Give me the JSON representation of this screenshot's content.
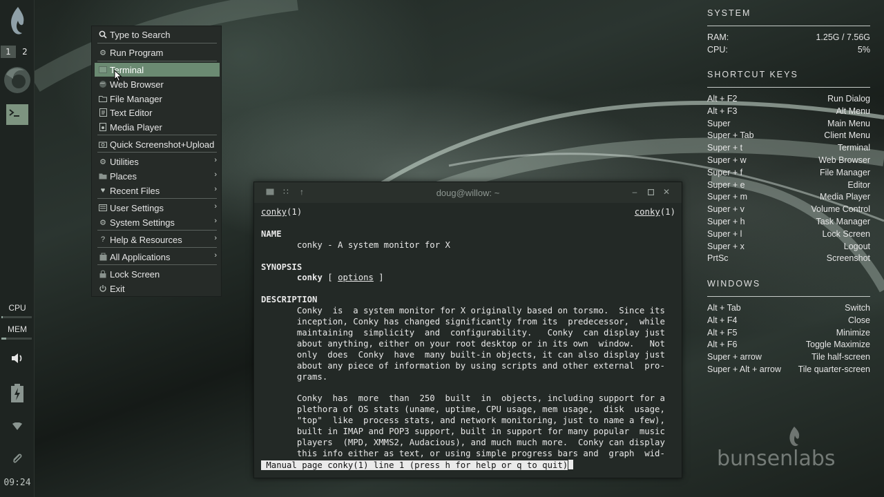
{
  "panel": {
    "workspaces": [
      "1",
      "2"
    ],
    "cpu_label": "CPU",
    "mem_label": "MEM",
    "cpu_fraction": 0.05,
    "mem_fraction": 0.16,
    "clock": "09:24"
  },
  "menu": {
    "items": [
      {
        "label": "Type to Search",
        "icon": "search-icon"
      },
      {
        "label": "Run Program",
        "icon": "gear-icon"
      },
      {
        "label": "Terminal",
        "icon": "terminal-icon",
        "highlighted": true
      },
      {
        "label": "Web Browser",
        "icon": "globe-icon"
      },
      {
        "label": "File Manager",
        "icon": "folder-icon"
      },
      {
        "label": "Text Editor",
        "icon": "text-editor-icon"
      },
      {
        "label": "Media Player",
        "icon": "media-player-icon"
      },
      {
        "label": "Quick Screenshot+Upload",
        "icon": "camera-icon"
      },
      {
        "label": "Utilities",
        "icon": "utilities-icon",
        "submenu": true
      },
      {
        "label": "Places",
        "icon": "folder-icon",
        "submenu": true
      },
      {
        "label": "Recent Files",
        "icon": "heart-icon",
        "submenu": true
      },
      {
        "label": "User Settings",
        "icon": "user-settings-icon",
        "submenu": true
      },
      {
        "label": "System Settings",
        "icon": "system-settings-icon",
        "submenu": true
      },
      {
        "label": "Help & Resources",
        "icon": "help-icon",
        "submenu": true
      },
      {
        "label": "All Applications",
        "icon": "applications-icon",
        "submenu": true
      },
      {
        "label": "Lock Screen",
        "icon": "lock-icon"
      },
      {
        "label": "Exit",
        "icon": "power-icon"
      }
    ]
  },
  "terminal": {
    "title": "doug@willow: ~",
    "header_left": "conky",
    "header_left_sect": "(1)",
    "header_right": "conky",
    "header_right_sect": "(1)",
    "name_heading": "NAME",
    "name_line": "       conky - A system monitor for X",
    "synopsis_heading": "SYNOPSIS",
    "synopsis_cmd": "conky",
    "synopsis_open": " [ ",
    "synopsis_opt": "options",
    "synopsis_close": " ]",
    "description_heading": "DESCRIPTION",
    "paragraph1": [
      "       Conky  is  a system monitor for X originally based on torsmo.  Since its",
      "       inception, Conky has changed significantly from its  predecessor,  while",
      "       maintaining  simplicity  and  configurability.   Conky  can display just",
      "       about anything, either on your root desktop or in its own  window.   Not",
      "       only  does  Conky  have  many built-in objects, it can also display just",
      "       about any piece of information by using scripts and other external  pro-",
      "       grams."
    ],
    "paragraph2": [
      "       Conky  has  more  than  250  built  in  objects, including support for a",
      "       plethora of OS stats (uname, uptime, CPU usage, mem usage,  disk  usage,",
      "       \"top\"  like  process stats, and network monitoring, just to name a few),",
      "       built in IMAP and POP3 support, built in support for many popular  music",
      "       players  (MPD, XMMS2, Audacious), and much much more.  Conky can display",
      "       this info either as text, or using simple progress bars and  graph  wid-"
    ],
    "status_line": " Manual page conky(1) line 1 (press h for help or q to quit)"
  },
  "conky": {
    "system_title": "SYSTEM",
    "system_rows": [
      {
        "key": "RAM:",
        "value": "1.25G / 7.56G"
      },
      {
        "key": "CPU:",
        "value": "5%"
      }
    ],
    "shortcut_title": "SHORTCUT KEYS",
    "shortcut_rows": [
      {
        "key": "Alt + F2",
        "value": "Run Dialog"
      },
      {
        "key": "Alt + F3",
        "value": "Alt Menu"
      },
      {
        "key": "Super",
        "value": "Main Menu"
      },
      {
        "key": "Super + Tab",
        "value": "Client Menu"
      },
      {
        "key": "Super + t",
        "value": "Terminal"
      },
      {
        "key": "Super + w",
        "value": "Web Browser"
      },
      {
        "key": "Super + f",
        "value": "File Manager"
      },
      {
        "key": "Super + e",
        "value": "Editor"
      },
      {
        "key": "Super + m",
        "value": "Media Player"
      },
      {
        "key": "Super + v",
        "value": "Volume Control"
      },
      {
        "key": "Super + h",
        "value": "Task Manager"
      },
      {
        "key": "Super + l",
        "value": "Lock Screen"
      },
      {
        "key": "Super + x",
        "value": "Logout"
      },
      {
        "key": "PrtSc",
        "value": "Screenshot"
      }
    ],
    "windows_title": "WINDOWS",
    "windows_rows": [
      {
        "key": "Alt + Tab",
        "value": "Switch"
      },
      {
        "key": "Alt + F4",
        "value": "Close"
      },
      {
        "key": "Alt + F5",
        "value": "Minimize"
      },
      {
        "key": "Alt + F6",
        "value": "Toggle Maximize"
      },
      {
        "key": "Super + arrow",
        "value": "Tile half-screen"
      },
      {
        "key": "Super + Alt + arrow",
        "value": "Tile quarter-screen"
      }
    ]
  },
  "branding": {
    "logo_text": "bunsenlabs"
  },
  "colors": {
    "menu_highlight": "#6b8a72",
    "panel_bg": "#1e2421",
    "terminal_bg": "#232926"
  }
}
